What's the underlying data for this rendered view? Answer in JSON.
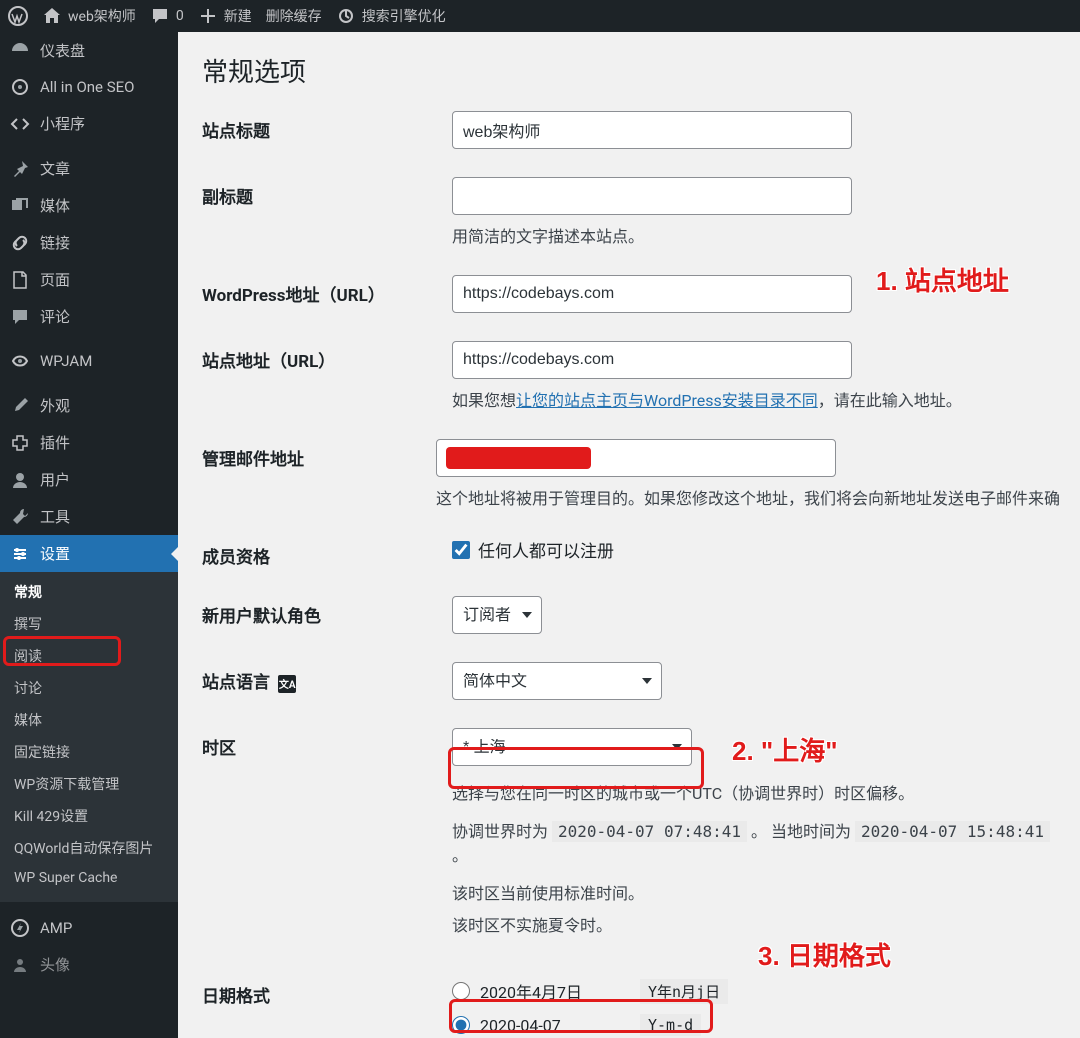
{
  "topbar": {
    "site_name": "web架构师",
    "comments_count": "0",
    "new_label": "新建",
    "cache_clear": "删除缓存",
    "seo_label": "搜索引擎优化"
  },
  "sidebar": {
    "items": [
      {
        "label": "仪表盘",
        "icon": "dashboard"
      },
      {
        "label": "All in One SEO",
        "icon": "aioseo"
      },
      {
        "label": "小程序",
        "icon": "code"
      },
      {
        "label": "文章",
        "icon": "pin"
      },
      {
        "label": "媒体",
        "icon": "media"
      },
      {
        "label": "链接",
        "icon": "link"
      },
      {
        "label": "页面",
        "icon": "page"
      },
      {
        "label": "评论",
        "icon": "comment"
      },
      {
        "label": "WPJAM",
        "icon": "wpjam"
      },
      {
        "label": "外观",
        "icon": "appearance"
      },
      {
        "label": "插件",
        "icon": "plugin"
      },
      {
        "label": "用户",
        "icon": "user"
      },
      {
        "label": "工具",
        "icon": "tool"
      },
      {
        "label": "设置",
        "icon": "settings"
      },
      {
        "label": "AMP",
        "icon": "amp"
      },
      {
        "label": "头像",
        "icon": "avatar"
      }
    ],
    "settings_sub": [
      "常规",
      "撰写",
      "阅读",
      "讨论",
      "媒体",
      "固定链接",
      "WP资源下载管理",
      "Kill 429设置",
      "QQWorld自动保存图片",
      "WP Super Cache"
    ]
  },
  "page": {
    "title": "常规选项",
    "labels": {
      "site_title": "站点标题",
      "tagline": "副标题",
      "wp_url": "WordPress地址（URL）",
      "site_url": "站点地址（URL）",
      "admin_email": "管理邮件地址",
      "membership": "成员资格",
      "default_role": "新用户默认角色",
      "site_lang": "站点语言",
      "timezone": "时区",
      "date_format": "日期格式"
    },
    "values": {
      "site_title": "web架构师",
      "tagline": "",
      "wp_url": "https://codebays.com",
      "site_url": "https://codebays.com",
      "default_role": "订阅者",
      "site_lang": "简体中文",
      "timezone": "* 上海"
    },
    "help": {
      "tagline": "用简洁的文字描述本站点。",
      "site_url_pre": "如果您想",
      "site_url_link": "让您的站点主页与WordPress安装目录不同",
      "site_url_post": "，请在此输入地址。",
      "admin_email": "这个地址将被用于管理目的。如果您修改这个地址，我们将会向新地址发送电子邮件来确",
      "membership_cb": "任何人都可以注册",
      "tz_help1": "选择与您在同一时区的城市或一个UTC（协调世界时）时区偏移。",
      "tz_utc_pre": "协调世界时为 ",
      "tz_utc_val": "2020-04-07 07:48:41",
      "tz_sep": " 。 ",
      "tz_local_pre": "当地时间为 ",
      "tz_local_val": "2020-04-07 15:48:41",
      "tz_end": " 。",
      "tz_std": "该时区当前使用标准时间。",
      "tz_dst": "该时区不实施夏令时。"
    },
    "date_formats": [
      {
        "display": "2020年4月7日",
        "code": "Y年n月j日",
        "checked": false
      },
      {
        "display": "2020-04-07",
        "code": "Y-m-d",
        "checked": true
      }
    ]
  },
  "annotations": {
    "a1": "1. 站点地址",
    "a2": "2. \"上海\"",
    "a3": "3. 日期格式"
  }
}
